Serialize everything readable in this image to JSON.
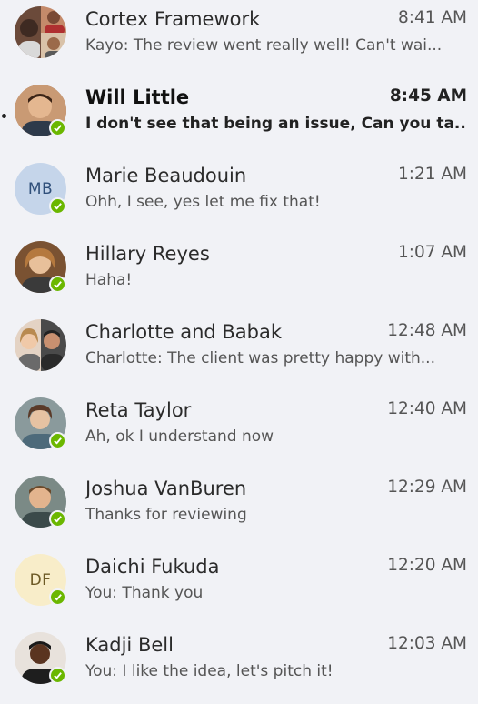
{
  "conversations": [
    {
      "name": "Cortex Framework",
      "time": "8:41 AM",
      "preview": "Kayo: The review went really well! Can't wai...",
      "unread": false,
      "presence": false
    },
    {
      "name": "Will Little",
      "time": "8:45 AM",
      "preview": "I don't see that being an issue, Can you ta...",
      "unread": true,
      "presence": true
    },
    {
      "name": "Marie Beaudouin",
      "time": "1:21 AM",
      "preview": "Ohh, I see, yes let me fix that!",
      "unread": false,
      "presence": true,
      "initials": "MB"
    },
    {
      "name": "Hillary Reyes",
      "time": "1:07 AM",
      "preview": "Haha!",
      "unread": false,
      "presence": true
    },
    {
      "name": "Charlotte and Babak",
      "time": "12:48 AM",
      "preview": "Charlotte: The client was pretty happy with...",
      "unread": false,
      "presence": false
    },
    {
      "name": "Reta Taylor",
      "time": "12:40 AM",
      "preview": "Ah, ok I understand now",
      "unread": false,
      "presence": true
    },
    {
      "name": "Joshua VanBuren",
      "time": "12:29 AM",
      "preview": "Thanks for reviewing",
      "unread": false,
      "presence": true
    },
    {
      "name": "Daichi Fukuda",
      "time": "12:20 AM",
      "preview": "You: Thank you",
      "unread": false,
      "presence": true,
      "initials": "DF"
    },
    {
      "name": "Kadji Bell",
      "time": "12:03 AM",
      "preview": "You: I like the idea, let's pitch it!",
      "unread": false,
      "presence": true
    }
  ],
  "colors": {
    "presence": "#6bb700",
    "mb_bg": "#c5d5ea",
    "mb_fg": "#2f4f7a",
    "df_bg": "#f8edc9",
    "df_fg": "#6d5a26"
  }
}
